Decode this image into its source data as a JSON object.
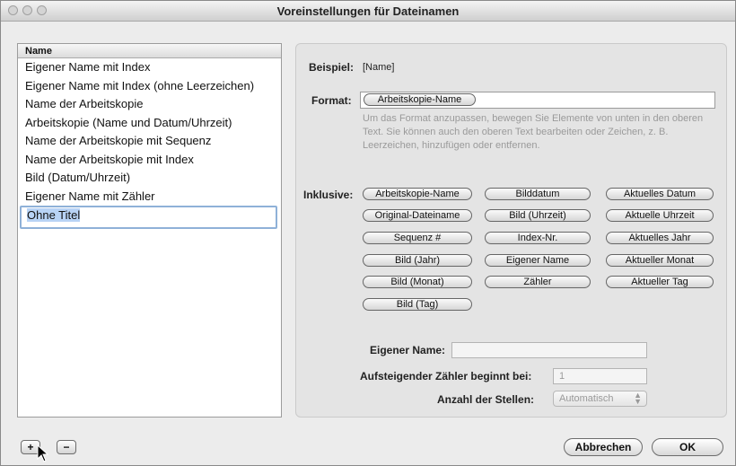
{
  "window": {
    "title": "Voreinstellungen für Dateinamen"
  },
  "list": {
    "header": "Name",
    "items": [
      "Eigener Name mit Index",
      "Eigener Name mit Index (ohne Leerzeichen)",
      "Name der Arbeitskopie",
      "Arbeitskopie (Name und Datum/Uhrzeit)",
      "Name der Arbeitskopie mit Sequenz",
      "Name der Arbeitskopie mit Index",
      "Bild (Datum/Uhrzeit)",
      "Eigener Name mit Zähler"
    ],
    "editing_item": "Ohne Titel"
  },
  "example": {
    "label": "Beispiel:",
    "value": "[Name]"
  },
  "format": {
    "label": "Format:",
    "token": "Arbeitskopie-Name",
    "help": "Um das Format anzupassen, bewegen Sie Elemente von unten in den oberen Text. Sie können auch den oberen Text bearbeiten oder Zeichen, z. B. Leerzeichen, hinzufügen oder entfernen."
  },
  "inklusive": {
    "label": "Inklusive:",
    "tokens": [
      [
        "Arbeitskopie-Name",
        "Bilddatum",
        "Aktuelles Datum"
      ],
      [
        "Original-Dateiname",
        "Bild (Uhrzeit)",
        "Aktuelle Uhrzeit"
      ],
      [
        "Sequenz #",
        "Index-Nr.",
        "Aktuelles Jahr"
      ],
      [
        "Bild (Jahr)",
        "Eigener Name",
        "Aktueller Monat"
      ],
      [
        "Bild (Monat)",
        "Zähler",
        "Aktueller Tag"
      ],
      [
        "Bild (Tag)"
      ]
    ]
  },
  "custom_name": {
    "label": "Eigener Name:",
    "value": ""
  },
  "counter_start": {
    "label": "Aufsteigender Zähler beginnt bei:",
    "value": "1"
  },
  "digits": {
    "label": "Anzahl der Stellen:",
    "value": "Automatisch"
  },
  "buttons": {
    "add": "+",
    "remove": "−",
    "cancel": "Abbrechen",
    "ok": "OK"
  }
}
